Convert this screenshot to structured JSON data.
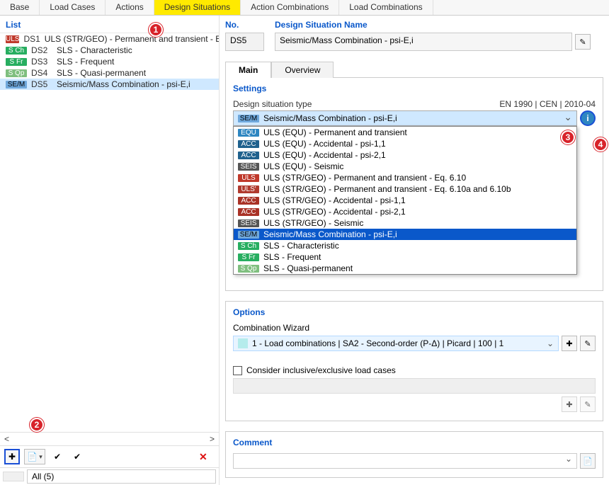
{
  "tabs": [
    "Base",
    "Load Cases",
    "Actions",
    "Design Situations",
    "Action Combinations",
    "Load Combinations"
  ],
  "activeTab": 3,
  "left": {
    "title": "List",
    "items": [
      {
        "badge": "ULS",
        "cls": "b-uls",
        "id": "DS1",
        "name": "ULS (STR/GEO) - Permanent and transient - E"
      },
      {
        "badge": "S Ch",
        "cls": "b-sch",
        "id": "DS2",
        "name": "SLS - Characteristic"
      },
      {
        "badge": "S Fr",
        "cls": "b-sfr",
        "id": "DS3",
        "name": "SLS - Frequent"
      },
      {
        "badge": "S Qp",
        "cls": "b-sqp",
        "id": "DS4",
        "name": "SLS - Quasi-permanent"
      },
      {
        "badge": "SE/M",
        "cls": "b-sem",
        "id": "DS5",
        "name": "Seismic/Mass Combination - psi-E,i"
      }
    ],
    "selected": 4,
    "filter": "All (5)"
  },
  "right": {
    "noLabel": "No.",
    "noValue": "DS5",
    "nameLabel": "Design Situation Name",
    "nameValue": "Seismic/Mass Combination - psi-E,i",
    "subTabs": [
      "Main",
      "Overview"
    ],
    "activeSubTab": 0,
    "settings": {
      "title": "Settings",
      "typeLabel": "Design situation type",
      "standard": "EN 1990 | CEN | 2010-04",
      "current": {
        "badge": "SE/M",
        "cls": "b-sem",
        "text": "Seismic/Mass Combination - psi-E,i"
      },
      "options": [
        {
          "badge": "EQU",
          "cls": "b-equ",
          "text": "ULS (EQU) - Permanent and transient"
        },
        {
          "badge": "ACC",
          "cls": "b-acc",
          "text": "ULS (EQU) - Accidental - psi-1,1"
        },
        {
          "badge": "ACC",
          "cls": "b-acc",
          "text": "ULS (EQU) - Accidental - psi-2,1"
        },
        {
          "badge": "SEIS",
          "cls": "b-seis",
          "text": "ULS (EQU) - Seismic"
        },
        {
          "badge": "ULS",
          "cls": "b-uls",
          "text": "ULS (STR/GEO) - Permanent and transient - Eq. 6.10"
        },
        {
          "badge": "ULS'",
          "cls": "b-uls2",
          "text": "ULS (STR/GEO) - Permanent and transient - Eq. 6.10a and 6.10b"
        },
        {
          "badge": "ACC",
          "cls": "b-acc2",
          "text": "ULS (STR/GEO) - Accidental - psi-1,1"
        },
        {
          "badge": "ACC",
          "cls": "b-acc2",
          "text": "ULS (STR/GEO) - Accidental - psi-2,1"
        },
        {
          "badge": "SEIS",
          "cls": "b-seis",
          "text": "ULS (STR/GEO) - Seismic"
        },
        {
          "badge": "SE/M",
          "cls": "b-sem",
          "text": "Seismic/Mass Combination - psi-E,i"
        },
        {
          "badge": "S Ch",
          "cls": "b-sch",
          "text": "SLS - Characteristic"
        },
        {
          "badge": "S Fr",
          "cls": "b-sfr",
          "text": "SLS - Frequent"
        },
        {
          "badge": "S Qp",
          "cls": "b-sqp",
          "text": "SLS - Quasi-permanent"
        }
      ],
      "selectedOption": 9
    },
    "options": {
      "title": "Options",
      "cwLabel": "Combination Wizard",
      "cwValue": "1 - Load combinations | SA2 - Second-order (P-Δ) | Picard | 100 | 1",
      "chkLabel": "Consider inclusive/exclusive load cases"
    },
    "comment": {
      "title": "Comment",
      "value": ""
    }
  },
  "markers": {
    "m1": "1",
    "m2": "2",
    "m3": "3",
    "m4": "4"
  }
}
